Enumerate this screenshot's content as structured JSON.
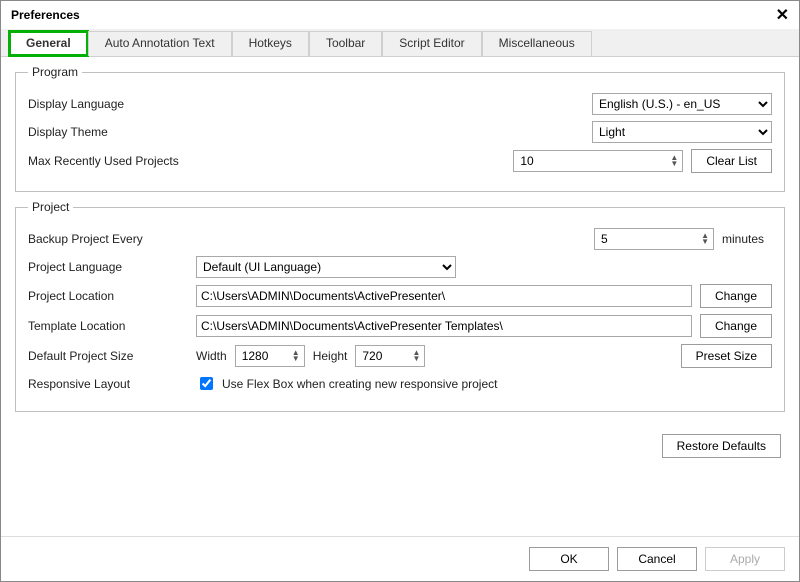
{
  "title": "Preferences",
  "tabs": [
    "General",
    "Auto Annotation Text",
    "Hotkeys",
    "Toolbar",
    "Script Editor",
    "Miscellaneous"
  ],
  "program": {
    "legend": "Program",
    "language_label": "Display Language",
    "language_value": "English (U.S.) - en_US",
    "theme_label": "Display Theme",
    "theme_value": "Light",
    "mru_label": "Max Recently Used Projects",
    "mru_value": "10",
    "clear_list": "Clear List"
  },
  "project": {
    "legend": "Project",
    "backup_label": "Backup Project Every",
    "backup_value": "5",
    "backup_unit": "minutes",
    "lang_label": "Project Language",
    "lang_value": "Default (UI Language)",
    "loc_label": "Project Location",
    "loc_value": "C:\\Users\\ADMIN\\Documents\\ActivePresenter\\",
    "tpl_label": "Template Location",
    "tpl_value": "C:\\Users\\ADMIN\\Documents\\ActivePresenter Templates\\",
    "change": "Change",
    "size_label": "Default Project Size",
    "width_label": "Width",
    "width_value": "1280",
    "height_label": "Height",
    "height_value": "720",
    "preset": "Preset Size",
    "resp_label": "Responsive Layout",
    "resp_check": "Use Flex Box when creating new responsive project"
  },
  "restore": "Restore Defaults",
  "footer": {
    "ok": "OK",
    "cancel": "Cancel",
    "apply": "Apply"
  }
}
